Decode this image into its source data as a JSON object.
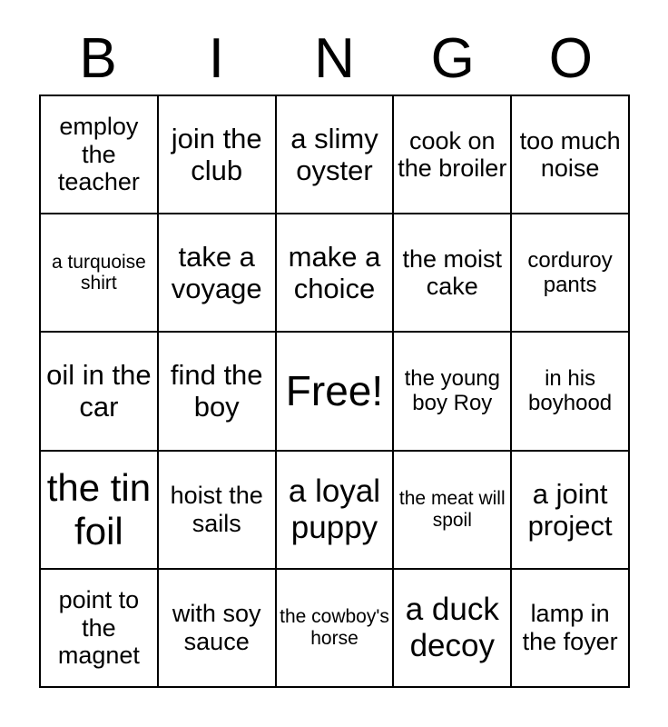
{
  "card": {
    "title": "BINGO Card",
    "header_letters": [
      "B",
      "I",
      "N",
      "G",
      "O"
    ],
    "grid_size": "5x5",
    "free_space_label": "Free!",
    "colors": {
      "background": "#ffffff",
      "text": "#000000",
      "grid_line": "#000000"
    },
    "rows": [
      [
        {
          "text": "employ the teacher",
          "size": "md"
        },
        {
          "text": "join the club",
          "size": "lg"
        },
        {
          "text": "a slimy oyster",
          "size": "lg"
        },
        {
          "text": "cook on the broiler",
          "size": "md"
        },
        {
          "text": "too much noise",
          "size": "md"
        }
      ],
      [
        {
          "text": "a turquoise shirt",
          "size": "xs"
        },
        {
          "text": "take a voyage",
          "size": "lg"
        },
        {
          "text": "make a choice",
          "size": "lg"
        },
        {
          "text": "the moist cake",
          "size": "md"
        },
        {
          "text": "corduroy pants",
          "size": "sm"
        }
      ],
      [
        {
          "text": "oil in the car",
          "size": "lg"
        },
        {
          "text": "find the boy",
          "size": "lg"
        },
        {
          "text": "Free!",
          "size": "free",
          "free_space": true
        },
        {
          "text": "the young boy Roy",
          "size": "sm"
        },
        {
          "text": "in his boyhood",
          "size": "sm"
        }
      ],
      [
        {
          "text": "the tin foil",
          "size": "xxl"
        },
        {
          "text": "hoist the sails",
          "size": "md"
        },
        {
          "text": "a loyal puppy",
          "size": "xl"
        },
        {
          "text": "the meat will spoil",
          "size": "xs"
        },
        {
          "text": "a joint project",
          "size": "lg"
        }
      ],
      [
        {
          "text": "point to the magnet",
          "size": "md"
        },
        {
          "text": "with soy sauce",
          "size": "md"
        },
        {
          "text": "the cowboy's horse",
          "size": "xs"
        },
        {
          "text": "a duck decoy",
          "size": "xl"
        },
        {
          "text": "lamp in the foyer",
          "size": "md"
        }
      ]
    ]
  }
}
